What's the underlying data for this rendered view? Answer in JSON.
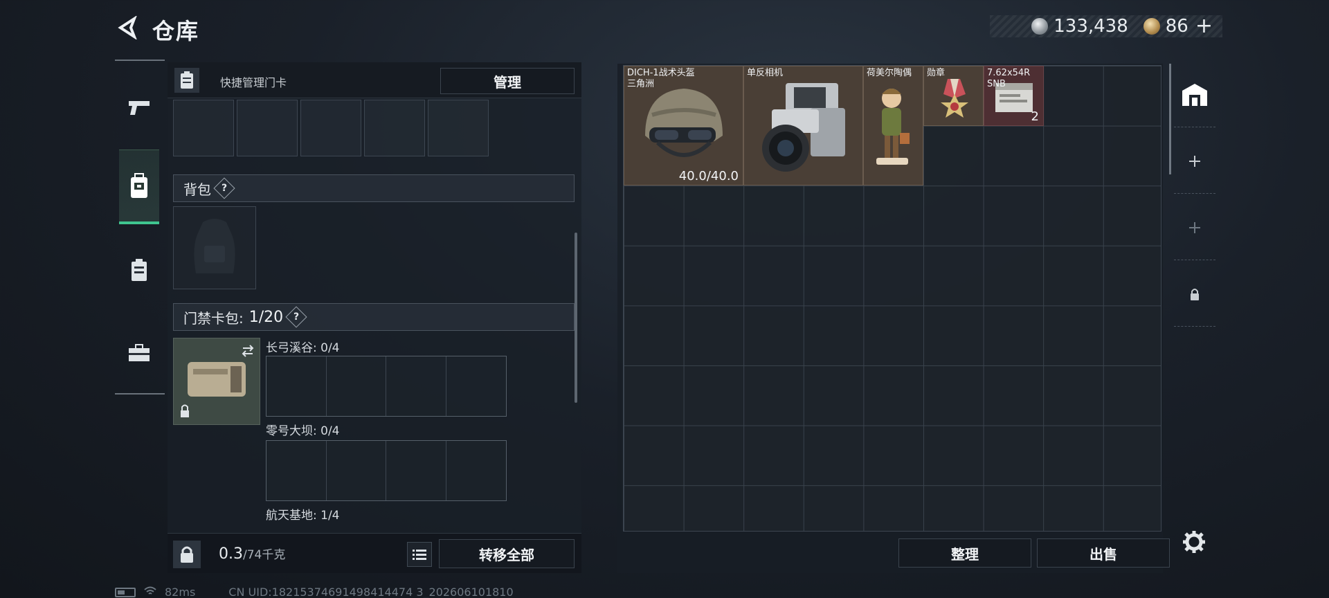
{
  "header": {
    "title": "仓库",
    "currency_silver": "133,438",
    "currency_gold": "86",
    "plus": "+"
  },
  "quick_bar": {
    "label": "快捷管理门卡",
    "manage_button": "管理"
  },
  "backpack": {
    "label": "背包",
    "help": "?"
  },
  "keycard_pack": {
    "label": "门禁卡包:",
    "count": "1/20",
    "help": "?",
    "maps": [
      {
        "name": "长弓溪谷: 0/4"
      },
      {
        "name": "零号大坝: 0/4"
      },
      {
        "name": "航天基地: 1/4"
      }
    ]
  },
  "bottom": {
    "weight_value": "0.3",
    "weight_max": "/74千克",
    "transfer_all": "转移全部"
  },
  "storage": {
    "items": [
      {
        "name": "DICH-1战术头盔\n三角洲",
        "durability": "40.0/40.0",
        "icon": "helmet-icon"
      },
      {
        "name": "单反相机",
        "icon": "camera-icon"
      },
      {
        "name": "荷美尔陶偶",
        "icon": "figurine-icon"
      },
      {
        "name": "勋章",
        "icon": "medal-icon"
      },
      {
        "name": "7.62x54R\nSNB",
        "qty": "2",
        "icon": "ammo-box-icon"
      }
    ],
    "sort_button": "整理",
    "sell_button": "出售"
  },
  "status": {
    "ping": "82ms",
    "uid": "CN UID:18215374691498414474 3_202606101810"
  },
  "colors": {
    "accent_green": "#3fc590",
    "item_bg": "#4a3f36",
    "ammo_bg": "#4e2f33"
  }
}
